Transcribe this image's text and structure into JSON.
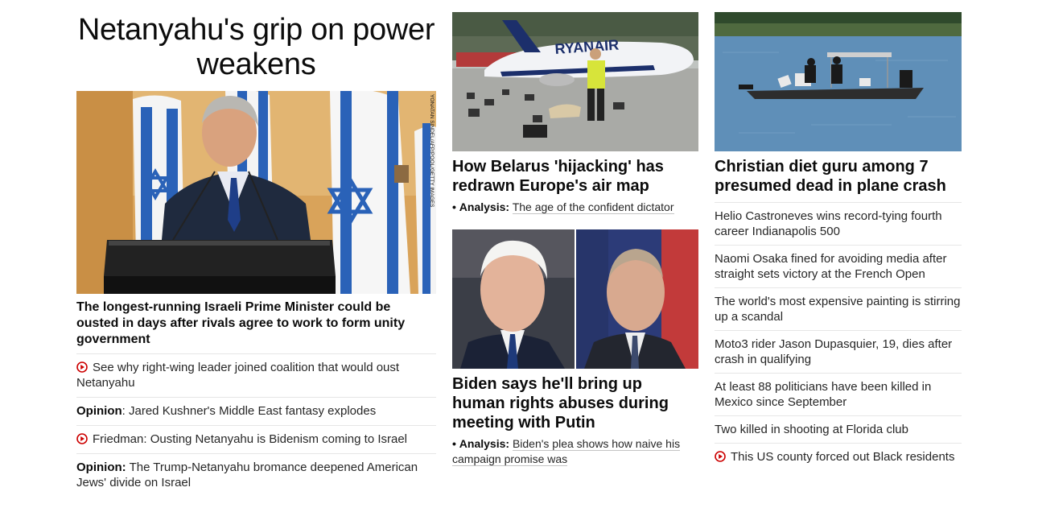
{
  "lead": {
    "headline": "Netanyahu's grip on power weakens",
    "image_alt": "Netanyahu speaking at a podium in front of Israeli flags",
    "photo_credit": "YONATAN SINDEL/AFP/POOL/GETTY IMAGES",
    "caption": "The longest-running Israeli Prime Minister could be ousted in days after rivals agree to work to form unity government",
    "links": [
      {
        "prefix": "",
        "text": "See why right-wing leader joined coalition that would oust Netanyahu",
        "video": true
      },
      {
        "prefix": "Opinion",
        "sep": ": ",
        "text": "Jared Kushner's Middle East fantasy explodes",
        "video": false
      },
      {
        "prefix": "",
        "text": "Friedman: Ousting Netanyahu is Bidenism coming to Israel",
        "video": true
      },
      {
        "prefix": "Opinion:",
        "sep": " ",
        "text": "The Trump-Netanyahu bromance deepened American Jews' divide on Israel",
        "video": false
      }
    ]
  },
  "belarus": {
    "title": "How Belarus 'hijacking' has redrawn Europe's air map",
    "bullet": "•",
    "analysis_label": "Analysis:",
    "analysis_text": "The age of the confident dictator",
    "image_alt": "Ryanair plane on tarmac with luggage and sniffer dog"
  },
  "biden": {
    "title": "Biden says he'll bring up human rights abuses during meeting with Putin",
    "bullet": "•",
    "analysis_label": "Analysis:",
    "analysis_text": "Biden's plea shows how naive his campaign promise was",
    "image_alt": "Joe Biden and Vladimir Putin side by side"
  },
  "crash": {
    "title": "Christian diet guru among 7 presumed dead in plane crash",
    "image_alt": "Boat with divers collecting plane debris on a lake",
    "links": [
      {
        "text": "Helio Castroneves wins record-tying fourth career Indianapolis 500",
        "video": false
      },
      {
        "text": "Naomi Osaka fined for avoiding media after straight sets victory at the French Open",
        "video": false
      },
      {
        "text": "The world's most expensive painting is stirring up a scandal",
        "video": false
      },
      {
        "text": "Moto3 rider Jason Dupasquier, 19, dies after crash in qualifying",
        "video": false
      },
      {
        "text": "At least 88 politicians have been killed in Mexico since September",
        "video": false
      },
      {
        "text": "Two killed in shooting at Florida club",
        "video": false
      },
      {
        "text": "This US county forced out Black residents",
        "video": true
      }
    ]
  },
  "colors": {
    "accent_red": "#cc0000",
    "divider": "#e6e6e6",
    "text": "#0c0c0c"
  }
}
